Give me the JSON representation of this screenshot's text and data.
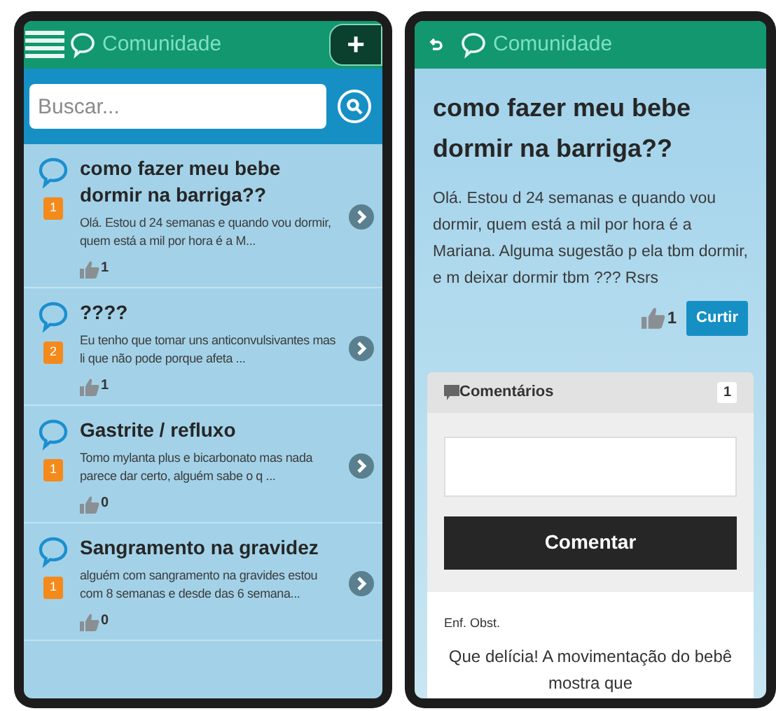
{
  "list_screen": {
    "header": {
      "title": "Comunidade",
      "add_button": "+"
    },
    "search": {
      "placeholder": "Buscar..."
    },
    "posts": [
      {
        "title": "como fazer meu bebe dormir na barriga??",
        "badge": "1",
        "excerpt": "Olá. Estou d 24 semanas e quando vou dormir, quem está a mil por hora é a M...",
        "likes": "1"
      },
      {
        "title": "????",
        "badge": "2",
        "excerpt": "Eu tenho que tomar uns anticonvulsivantes mas li que não pode porque afeta ...",
        "likes": "1"
      },
      {
        "title": "Gastrite / refluxo",
        "badge": "1",
        "excerpt": "Tomo mylanta plus e bicarbonato mas nada parece dar certo, alguém sabe o q ...",
        "likes": "0"
      },
      {
        "title": "Sangramento na gravidez",
        "badge": "1",
        "excerpt": "alguém com sangramento na gravides estou com 8 semanas e desde das 6 semana...",
        "likes": "0"
      }
    ]
  },
  "detail_screen": {
    "header": {
      "title": "Comunidade"
    },
    "title": "como fazer meu bebe dormir na barriga??",
    "body": "Olá. Estou d 24 semanas e quando vou dormir, quem está a mil por hora é a Mariana. Alguma sugestão p ela tbm dormir, e m deixar dormir tbm ??? Rsrs",
    "likes": "1",
    "like_button": "Curtir",
    "comments": {
      "title": "Comentários",
      "count": "1",
      "submit_button": "Comentar",
      "items": [
        {
          "author": "Enf. Obst.",
          "text": "Que delícia! A movimentação do bebê mostra que"
        }
      ]
    }
  }
}
